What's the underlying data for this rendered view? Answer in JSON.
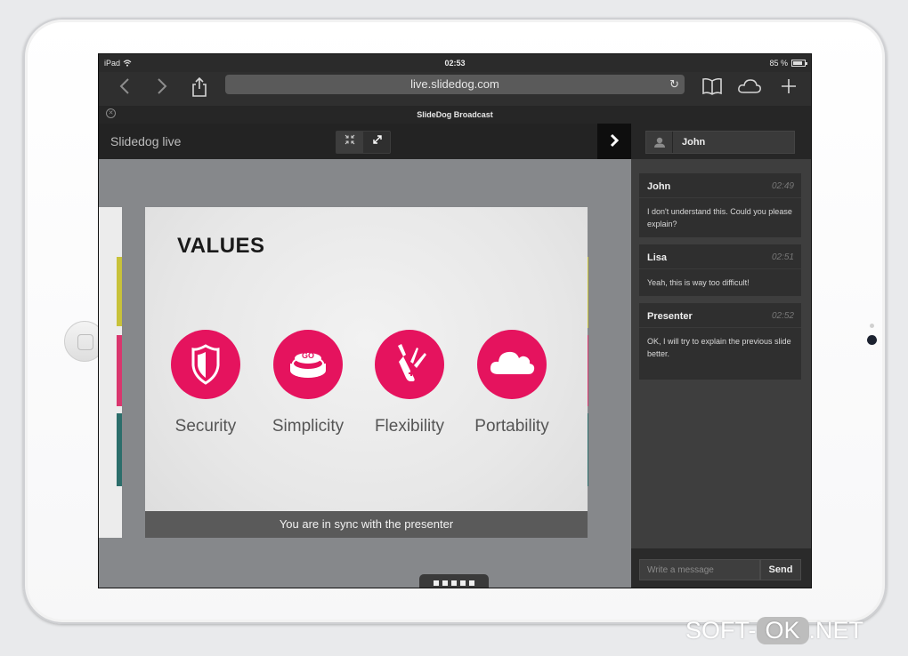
{
  "status_bar": {
    "device": "iPad",
    "time": "02:53",
    "battery": "85 %"
  },
  "browser": {
    "url": "live.slidedog.com",
    "tab_title": "SlideDog Broadcast",
    "icons": [
      "back-icon",
      "forward-icon",
      "share-icon",
      "reload-icon",
      "bookmarks-icon",
      "icloud-tabs-icon",
      "new-tab-icon"
    ]
  },
  "app": {
    "title": "Slidedog live"
  },
  "slide": {
    "heading": "VALUES",
    "values": [
      {
        "label": "Security",
        "icon": "shield-icon"
      },
      {
        "label": "Simplicity",
        "icon": "go-button-icon",
        "icon_text": "GO"
      },
      {
        "label": "Flexibility",
        "icon": "swiss-knife-icon"
      },
      {
        "label": "Portability",
        "icon": "cloud-icon"
      }
    ],
    "sync_message": "You are in sync with the presenter"
  },
  "chat": {
    "user_name": "John",
    "messages": [
      {
        "author": "John",
        "time": "02:49",
        "text": "I don't understand this. Could you please explain?"
      },
      {
        "author": "Lisa",
        "time": "02:51",
        "text": "Yeah, this is way too difficult!"
      },
      {
        "author": "Presenter",
        "time": "02:52",
        "text": "OK, I will try to explain the previous slide better."
      }
    ],
    "input_placeholder": "Write a message",
    "send_label": "Send"
  },
  "colors": {
    "accent": "#e5135e",
    "stripe_yellow": "#c8c23a",
    "stripe_pink": "#d9366e",
    "stripe_teal": "#2c6e6b"
  },
  "watermark": {
    "left": "SOFT-",
    "middle": "OK",
    "right": ".NET"
  }
}
